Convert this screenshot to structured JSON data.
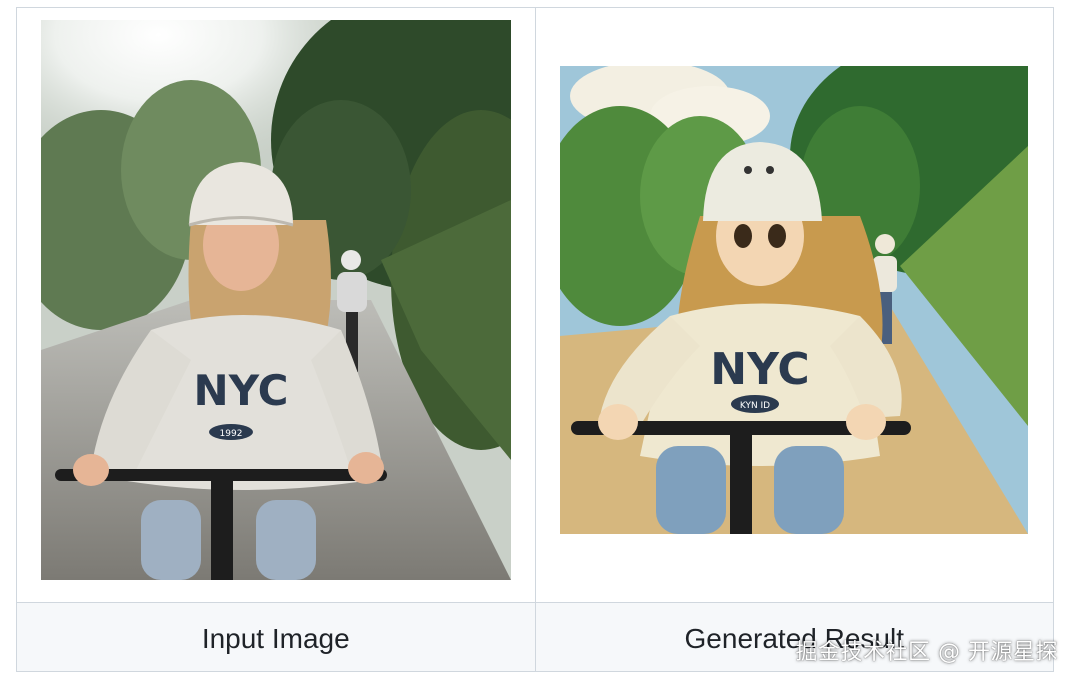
{
  "table": {
    "columns": [
      {
        "caption": "Input Image",
        "image": "photo of a girl riding a bicycle on a tree-lined road"
      },
      {
        "caption": "Generated Result",
        "image": "anime-style illustration of a girl riding a bicycle"
      }
    ]
  },
  "sweater_text": "NYC",
  "badge_text_photo": "1992",
  "badge_text_anime": "KYN ID",
  "watermark": "掘金技术社区 @ 开源星探",
  "colors": {
    "border": "#d0d7de",
    "caption_bg": "#f6f8fa",
    "caption_text": "#1f2328",
    "sweater_print": "#2b3a4f"
  }
}
